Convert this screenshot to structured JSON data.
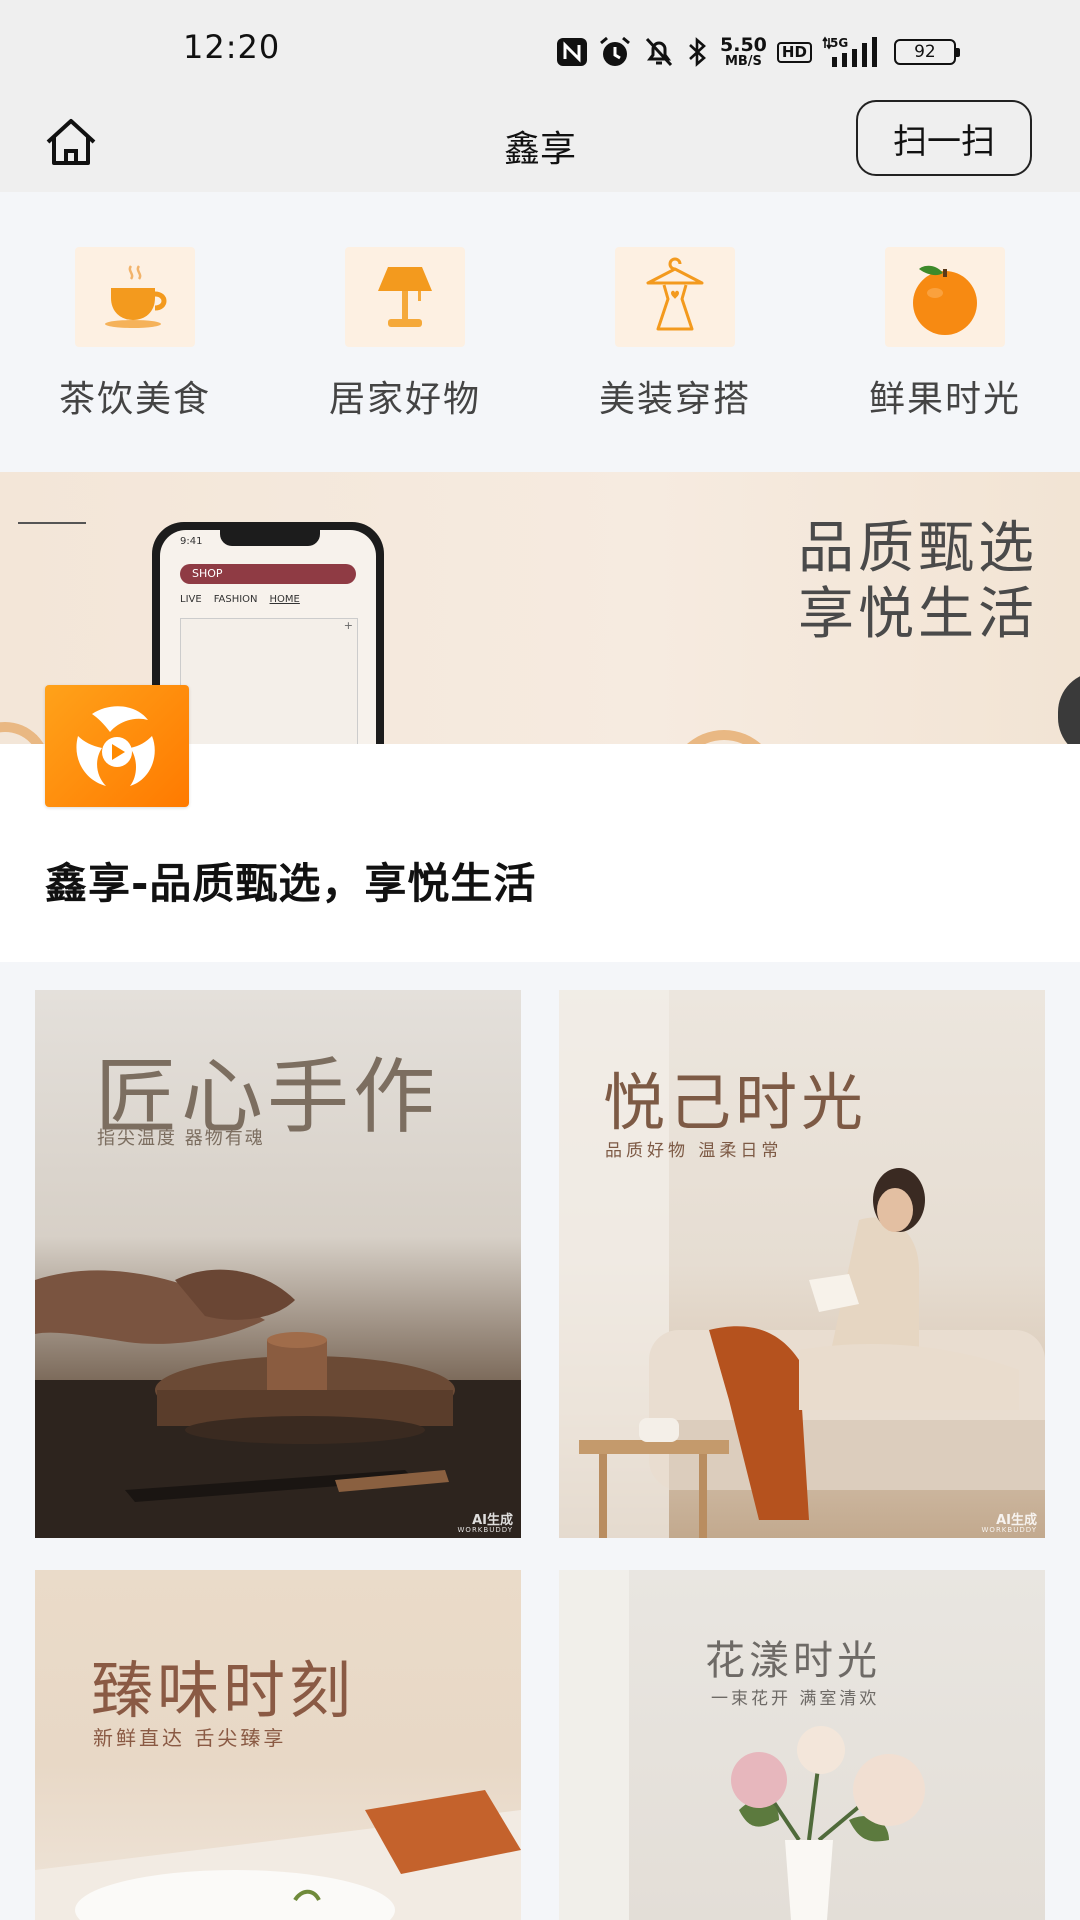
{
  "status_bar": {
    "time": "12:20",
    "speed_value": "5.50",
    "speed_unit": "MB/S",
    "hd": "HD",
    "network": "5G",
    "battery": "92",
    "icons": [
      "nfc-icon",
      "alarm-icon",
      "mute-bell-icon",
      "bluetooth-icon",
      "signal-icon",
      "battery-icon"
    ]
  },
  "header": {
    "title": "鑫享",
    "scan_label": "扫一扫",
    "home_icon": "home-icon"
  },
  "categories": [
    {
      "label": "茶饮美食",
      "icon": "tea-cup-icon"
    },
    {
      "label": "居家好物",
      "icon": "lamp-icon"
    },
    {
      "label": "美装穿搭",
      "icon": "dress-hanger-icon"
    },
    {
      "label": "鲜果时光",
      "icon": "orange-icon"
    }
  ],
  "banner": {
    "slogan_line1": "品质甄选",
    "slogan_line2": "享悦生活",
    "phone": {
      "time": "9:41",
      "shop": "SHOP",
      "tabs": [
        "LIVE",
        "FASHION",
        "HOME"
      ],
      "plus": "+"
    }
  },
  "intro": {
    "title": "鑫享-品质甄选，享悦生活"
  },
  "feed": [
    {
      "title": "匠心手作",
      "subtitle": "指尖温度 器物有魂",
      "mark": "AI生成",
      "mark_sub": "WORKBUDDY"
    },
    {
      "title": "悦己时光",
      "subtitle": "品质好物 温柔日常",
      "mark": "AI生成",
      "mark_sub": "WORKBUDDY"
    },
    {
      "title": "臻味时刻",
      "subtitle": "新鲜直达 舌尖臻享"
    },
    {
      "title": "花漾时光",
      "subtitle": "一束花开 满室清欢"
    }
  ],
  "colors": {
    "accent_orange": "#ff8a00",
    "category_bg": "#fdf0e2",
    "page_bg": "#f4f6f9"
  }
}
